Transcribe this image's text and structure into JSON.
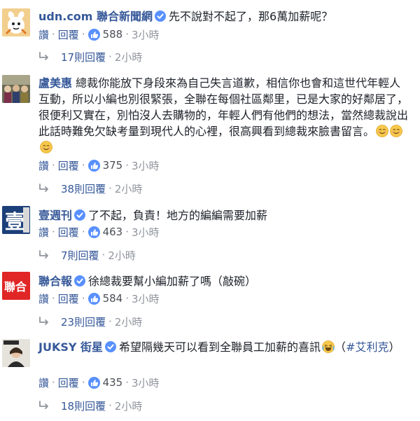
{
  "comments": [
    {
      "author": "udn.com 聯合新聞網",
      "verified": true,
      "text": "先不說對不起了，那6萬加薪呢？",
      "actions": {
        "like": "讚",
        "reply": "回覆",
        "likes": "588",
        "time": "3小時"
      },
      "replies": {
        "label": "17則回覆",
        "time": "2小時"
      }
    },
    {
      "author": "盧美惠",
      "verified": false,
      "text": "總裁你能放下身段來為自己失言道歉，相信你也會和這世代年輕人互動，所以小編也別很緊張，全聯在每個社區鄰里，已是大家的好鄰居了，很便利又實在，別怕沒人去購物的，年輕人們有他們的想法，當然總裁說出此話時難免欠缺考量到現代人的心裡，很高興看到總裁來臉書留言。",
      "actions": {
        "like": "讚",
        "reply": "回覆",
        "likes": "375",
        "time": "3小時"
      },
      "replies": {
        "label": "38則回覆",
        "time": "2小時"
      }
    },
    {
      "author": "壹週刊",
      "verified": true,
      "text": "了不起，負責！地方的編編需要加薪",
      "actions": {
        "like": "讚",
        "reply": "回覆",
        "likes": "463",
        "time": "3小時"
      },
      "replies": {
        "label": "7則回覆",
        "time": "2小時"
      }
    },
    {
      "author": "聯合報",
      "verified": true,
      "text": "徐總裁要幫小編加薪了嗎（敲碗）",
      "actions": {
        "like": "讚",
        "reply": "回覆",
        "likes": "584",
        "time": "3小時"
      },
      "replies": {
        "label": "23則回覆",
        "time": "2小時"
      }
    },
    {
      "author": "JUKSY 街星",
      "verified": true,
      "text": "希望隔幾天可以看到全聯員工加薪的喜訊",
      "hashtag": "#艾利克",
      "paren_open": "（",
      "paren_close": "）",
      "actions": {
        "like": "讚",
        "reply": "回覆",
        "likes": "435",
        "time": "3小時"
      },
      "replies": {
        "label": "18則回覆",
        "time": "2小時"
      }
    }
  ],
  "avatar_text": {
    "weekly": "壹",
    "udn_paper": "聯合"
  },
  "colors": {
    "link": "#365899",
    "like_blue": "#5890ff",
    "muted": "#90949c"
  }
}
